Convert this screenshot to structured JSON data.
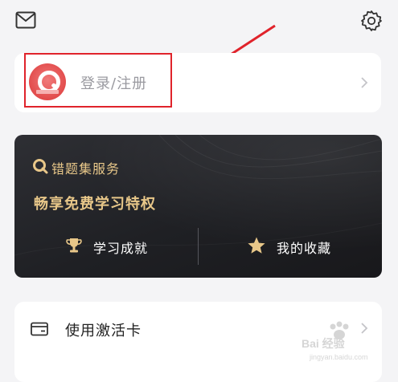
{
  "header": {
    "mail_icon": "mail-icon",
    "settings_icon": "gear-icon"
  },
  "login": {
    "label": "登录/注册",
    "avatar_icon": "app-logo-avatar",
    "chevron_icon": "chevron-right-icon"
  },
  "annotation": {
    "box_color": "#e0232b",
    "arrow_color": "#e0232b"
  },
  "service_card": {
    "title": "错题集服务",
    "subtitle": "畅享免费学习特权",
    "items": [
      {
        "label": "学习成就",
        "icon": "trophy-icon"
      },
      {
        "label": "我的收藏",
        "icon": "star-icon"
      }
    ],
    "accent_color": "#e8c789"
  },
  "activation": {
    "label": "使用激活卡",
    "icon": "card-icon",
    "chevron_icon": "chevron-right-icon"
  },
  "watermark": {
    "brand": "Bai 经验",
    "url": "jingyan.baidu.com"
  }
}
